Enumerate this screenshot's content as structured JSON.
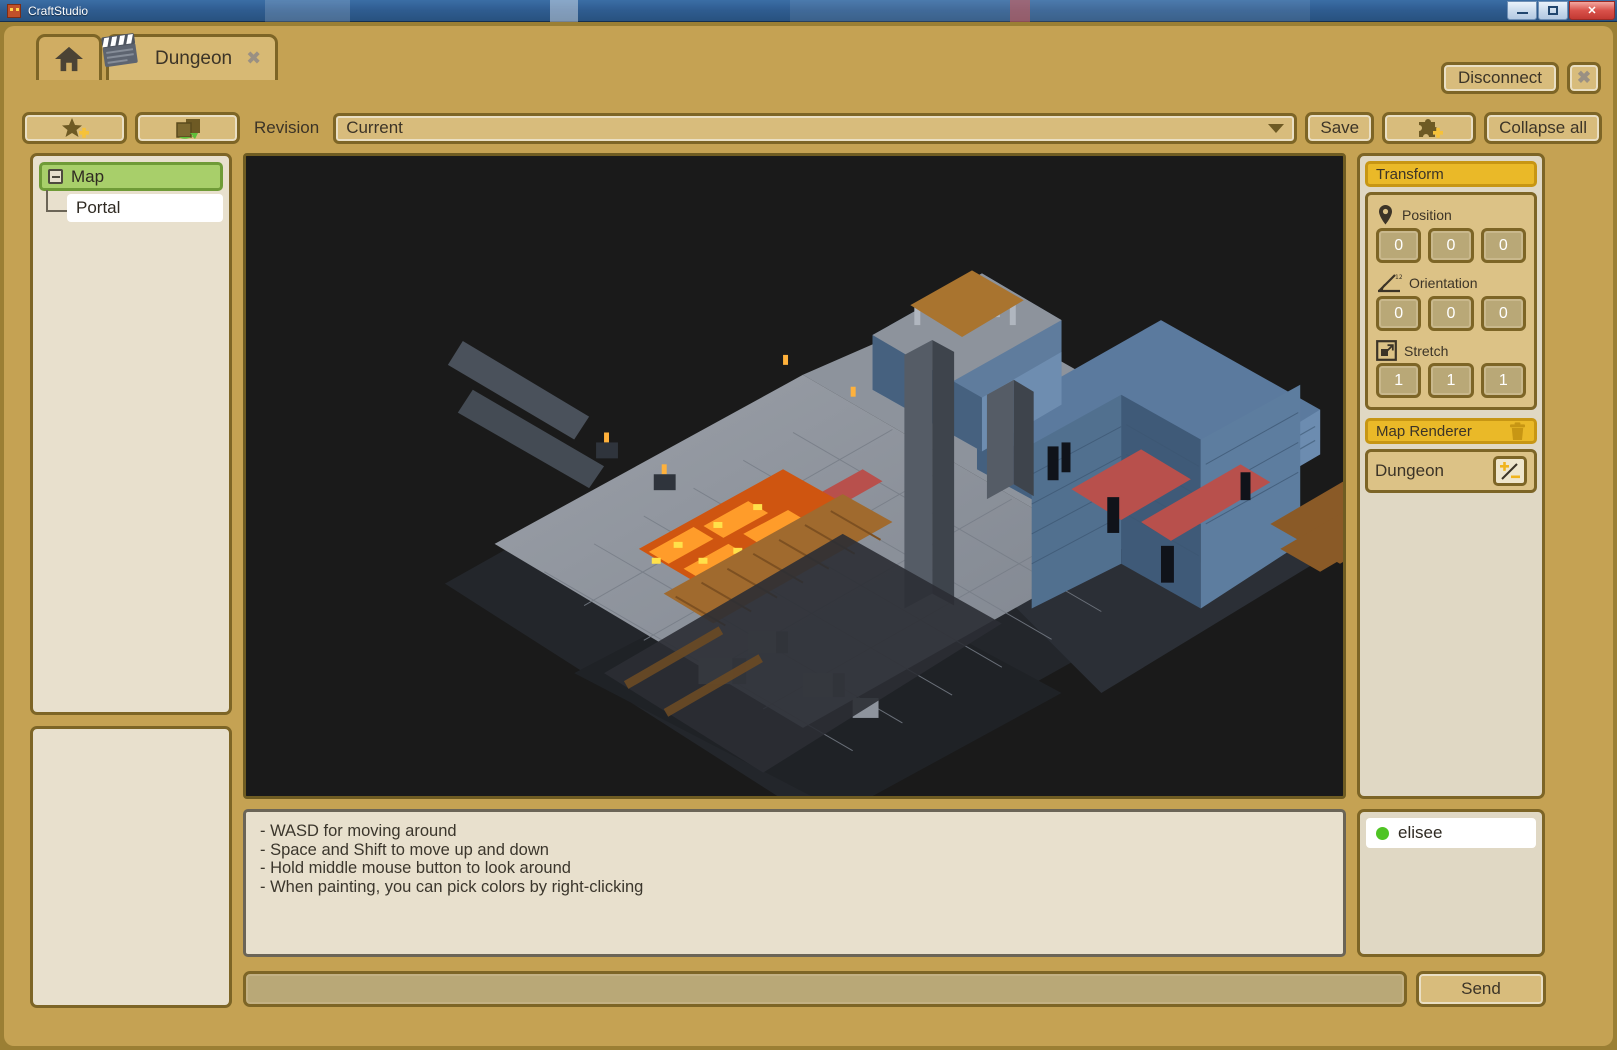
{
  "os_window": {
    "app_name": "CraftStudio",
    "icon": "craftstudio-cube-icon",
    "minimize_label": "",
    "maximize_label": "",
    "close_label": "✕"
  },
  "tabs": {
    "home_icon": "home-icon",
    "document": {
      "icon": "clapperboard-icon",
      "label": "Dungeon",
      "close_label": "✖"
    }
  },
  "header": {
    "disconnect_label": "Disconnect",
    "close_label": "✖"
  },
  "toolbar": {
    "favorite_icon": "star-plus-icon",
    "duplicate_icon": "duplicate-icon",
    "revision_label": "Revision",
    "revision_value": "Current",
    "save_label": "Save",
    "plugin_icon": "puzzle-plus-icon",
    "collapse_label": "Collapse all"
  },
  "tree": {
    "items": [
      {
        "label": "Map",
        "selected": true,
        "expanded": true
      },
      {
        "label": "Portal",
        "selected": false,
        "expanded": false
      }
    ]
  },
  "inspector": {
    "transform": {
      "title": "Transform",
      "position": {
        "label": "Position",
        "icon": "map-pin-icon",
        "values": [
          "0",
          "0",
          "0"
        ]
      },
      "orientation": {
        "label": "Orientation",
        "icon": "angle-degrees-icon",
        "values": [
          "0",
          "0",
          "0"
        ]
      },
      "stretch": {
        "label": "Stretch",
        "icon": "resize-arrow-icon",
        "values": [
          "1",
          "1",
          "1"
        ]
      }
    },
    "map_renderer": {
      "title": "Map Renderer",
      "delete_icon": "trash-icon",
      "asset_name": "Dungeon",
      "pick_icon": "plus-minus-icon"
    }
  },
  "help": {
    "lines": [
      "- WASD for moving around",
      "- Space and Shift to move up and down",
      "- Hold middle mouse button to look around",
      "- When painting, you can pick colors by right-clicking"
    ]
  },
  "users": {
    "list": [
      {
        "name": "elisee",
        "status": "online"
      }
    ]
  },
  "chat": {
    "input_value": "",
    "input_placeholder": "",
    "send_label": "Send"
  },
  "colors": {
    "accent_gold": "#eab928",
    "panel_tan": "#dcc286",
    "frame_brown": "#7d6526",
    "selected_green": "#a8cf6a",
    "online_green": "#4fc424",
    "viewport_bg": "#1a1a1a"
  }
}
